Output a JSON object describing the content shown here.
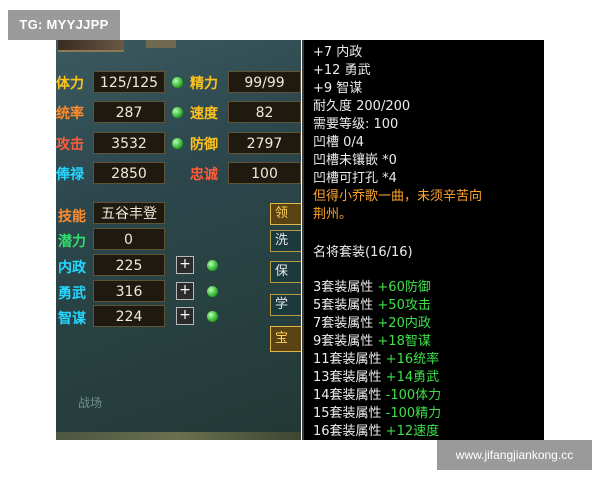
{
  "watermark_top": "TG: MYYJJPP",
  "watermark_bottom": "www.jifangjiankong.cc",
  "stats": {
    "tili": {
      "label": "体力",
      "value": "125/125"
    },
    "jingli": {
      "label": "精力",
      "value": "99/99"
    },
    "tongshuai": {
      "label": "统率",
      "value": "287"
    },
    "sudu": {
      "label": "速度",
      "value": "82"
    },
    "gongji": {
      "label": "攻击",
      "value": "3532"
    },
    "fangyu": {
      "label": "防御",
      "value": "2797"
    },
    "fenglu": {
      "label": "俸禄",
      "value": "2850"
    },
    "zhongcheng": {
      "label": "忠诚",
      "value": "100"
    }
  },
  "skills": {
    "jineng": {
      "label": "技能",
      "value": "五谷丰登"
    },
    "qianli": {
      "label": "潜力",
      "value": "0"
    },
    "neizheng": {
      "label": "内政",
      "value": "225"
    },
    "yongwu": {
      "label": "勇武",
      "value": "316"
    },
    "zhimou": {
      "label": "智谋",
      "value": "224"
    }
  },
  "plus_label": "+",
  "side_buttons": [
    "领",
    "洗",
    "保",
    "学",
    "宝"
  ],
  "bottom_tab": "战场",
  "tooltip": {
    "lines_top": [
      "+7 内政",
      "+12 勇武",
      "+9 智谋",
      "耐久度  200/200",
      "需要等级: 100",
      "凹槽   0/4",
      "凹槽未镶嵌  *0",
      "凹槽可打孔  *4"
    ],
    "quote_1": "但得小乔歌一曲，未须辛苦向",
    "quote_2": "荆州。",
    "set_name": "名将套装(16/16)",
    "set_bonuses": [
      {
        "label": "3套装属性",
        "value": " +60防御"
      },
      {
        "label": "5套装属性",
        "value": " +50攻击"
      },
      {
        "label": "7套装属性",
        "value": " +20内政"
      },
      {
        "label": "9套装属性",
        "value": " +18智谋"
      },
      {
        "label": "11套装属性",
        "value": " +16统率"
      },
      {
        "label": "13套装属性",
        "value": " +14勇武"
      },
      {
        "label": "14套装属性",
        "value": " -100体力"
      },
      {
        "label": "15套装属性",
        "value": " -100精力"
      },
      {
        "label": "16套装属性",
        "value": " +12速度"
      }
    ]
  }
}
